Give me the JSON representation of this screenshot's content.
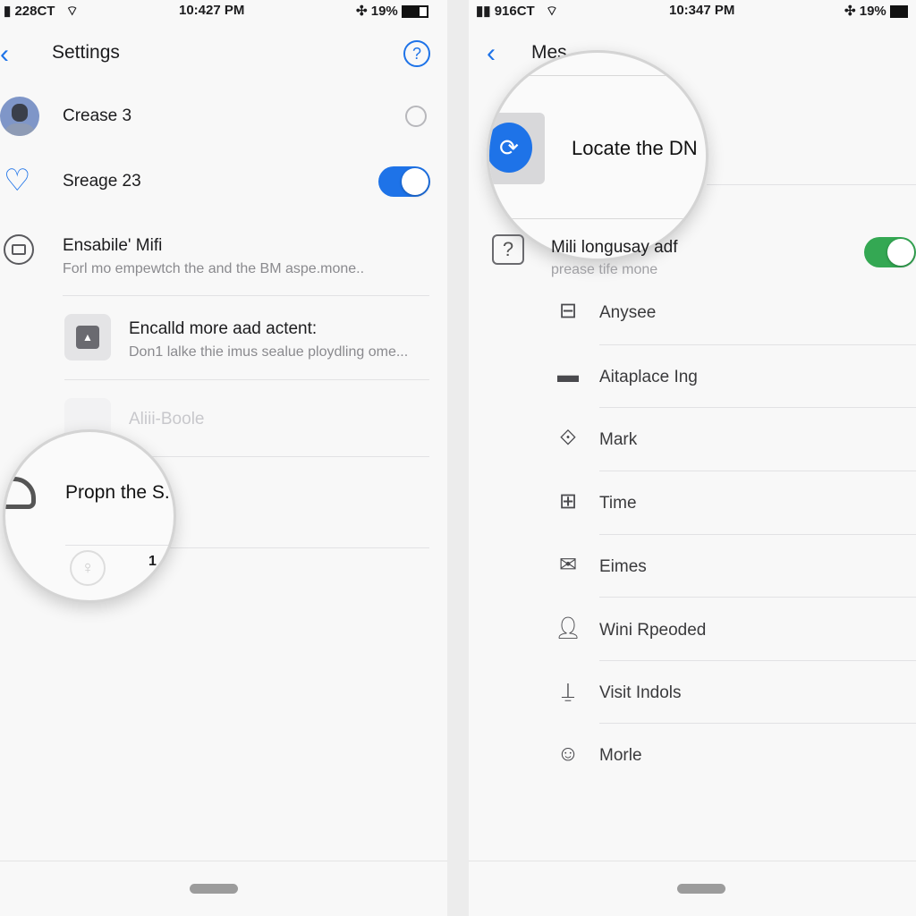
{
  "left": {
    "status": {
      "carrier": "228CT",
      "time": "10:427 PM",
      "battery": "19%"
    },
    "header": {
      "title": "Settings",
      "back_icon": "chevron-left-icon",
      "help_icon": "question-circle-icon"
    },
    "rows": [
      {
        "label": "Crease 3",
        "icon": "avatar",
        "control": "radio",
        "checked": false
      },
      {
        "label": "Sreage 23",
        "icon": "heart-icon",
        "control": "toggle",
        "on": true
      },
      {
        "label": "Ensabile' Mifi",
        "subtitle": "Forl mo empewtch the and the BM aspe.mone..",
        "icon": "inbox-icon"
      },
      {
        "label": "Encalld more aad actent:",
        "subtitle": "Don1 lalke thie imus sealue ploydling ome...",
        "icon": "app-tile-icon"
      },
      {
        "label": "Aliii-Boole",
        "icon": "app-tile-icon",
        "disabled": true
      }
    ],
    "magnifier": {
      "label": "Propn the S.",
      "extra": "1"
    }
  },
  "right": {
    "status": {
      "carrier": "916CT",
      "time": "10:347 PM",
      "battery": "19%"
    },
    "header": {
      "title": "Mes",
      "back_icon": "chevron-left-icon"
    },
    "magnifier": {
      "label": "Locate the DN"
    },
    "toggle_row": {
      "label": "Mili longusay adf",
      "subtitle": "prease tife mone",
      "on": true
    },
    "items": [
      {
        "label": "Anysee",
        "icon": "minus-square-icon"
      },
      {
        "label": "Aitaplace Ing",
        "icon": "folder-icon"
      },
      {
        "label": "Mark",
        "icon": "diamond-square-icon"
      },
      {
        "label": "Time",
        "icon": "grid-icon"
      },
      {
        "label": "Eimes",
        "icon": "mail-icon"
      },
      {
        "label": "Wini Rpeoded",
        "icon": "person-icon"
      },
      {
        "label": "Visit Indols",
        "icon": "signal-icon"
      },
      {
        "label": "Morle",
        "icon": "face-icon"
      }
    ]
  },
  "colors": {
    "accent": "#1e73e8",
    "toggle_green": "#34a853",
    "toggle_blue": "#1e73e8"
  }
}
